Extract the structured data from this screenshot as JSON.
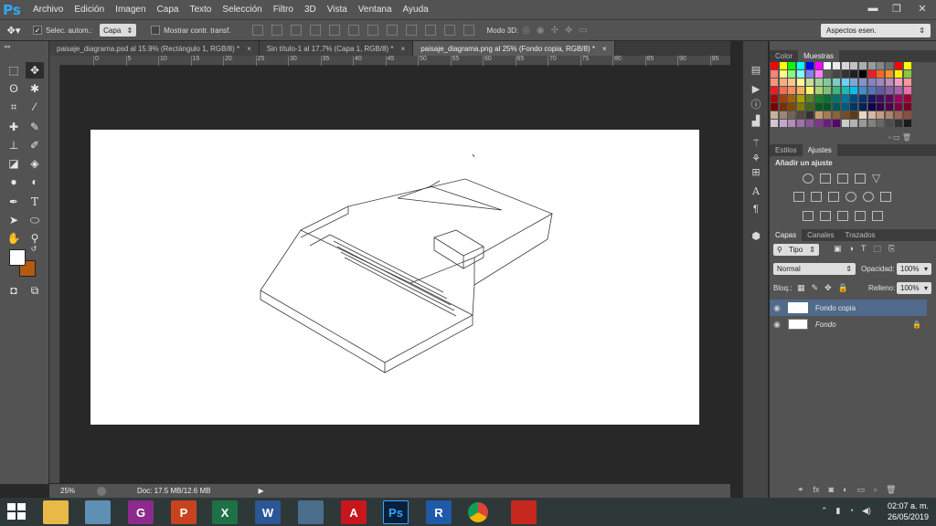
{
  "app": {
    "logo": "Ps"
  },
  "menu": [
    "Archivo",
    "Edición",
    "Imagen",
    "Capa",
    "Texto",
    "Selección",
    "Filtro",
    "3D",
    "Vista",
    "Ventana",
    "Ayuda"
  ],
  "window_controls": {
    "minimize": "▬",
    "restore": "❐",
    "close": "✕"
  },
  "options": {
    "auto_select_label": "Selec. autom.:",
    "auto_select_value": "Capa",
    "show_transform_label": "Mostrar contr. transf.",
    "mode3d_label": "Modo 3D:",
    "workspace": "Aspectos esen."
  },
  "tabs": [
    {
      "label": "paisaje_diagrama.psd al 15.9% (Rectángulo 1, RGB/8) *",
      "close": "×"
    },
    {
      "label": "Sin título-1 al 17.7% (Capa 1, RGB/8) *",
      "close": "×"
    },
    {
      "label": "paisaje_diagrama.png al 25% (Fondo copia, RGB/8) *",
      "close": "×"
    }
  ],
  "ruler": {
    "top": [
      "0",
      "5",
      "10",
      "15",
      "20",
      "25",
      "30",
      "35",
      "40",
      "45",
      "50",
      "55",
      "60",
      "65",
      "70",
      "75",
      "80",
      "85",
      "90",
      "95"
    ]
  },
  "status": {
    "zoom": "25%",
    "doc": "Doc: 17.5 MB/12.6 MB"
  },
  "panels": {
    "color_tabs": [
      "Color",
      "Muestras"
    ],
    "adjust_tabs": [
      "Estilos",
      "Ajustes"
    ],
    "adjust_title": "Añadir un ajuste",
    "layer_tabs": [
      "Capas",
      "Canales",
      "Trazados"
    ],
    "kind": "Tipo",
    "blend_mode": "Normal",
    "opacity_label": "Opacidad:",
    "opacity": "100%",
    "lock_label": "Bloq.:",
    "fill_label": "Relleno:",
    "fill": "100%",
    "layers": [
      {
        "name": "Fondo copia",
        "selected": true
      },
      {
        "name": "Fondo",
        "selected": false,
        "locked": true
      }
    ]
  },
  "clock": {
    "time": "02:07 a. m.",
    "date": "26/05/2019"
  },
  "taskbar_apps": [
    {
      "name": "windows-start",
      "label": "",
      "color": "#2e3838"
    },
    {
      "name": "file-explorer",
      "label": "",
      "color": "#e8b948"
    },
    {
      "name": "calculator",
      "label": "",
      "color": "#5f8fb5"
    },
    {
      "name": "pdf-app",
      "label": "G",
      "color": "#8d2b8d"
    },
    {
      "name": "powerpoint",
      "label": "P",
      "color": "#c7431f"
    },
    {
      "name": "excel",
      "label": "X",
      "color": "#1e7145"
    },
    {
      "name": "word",
      "label": "W",
      "color": "#2b5797"
    },
    {
      "name": "network-app",
      "label": "",
      "color": "#4a6d8c"
    },
    {
      "name": "autocad",
      "label": "A",
      "color": "#c8161d"
    },
    {
      "name": "photoshop",
      "label": "Ps",
      "color": "#0b1e3b"
    },
    {
      "name": "revit",
      "label": "R",
      "color": "#1f5aa8"
    },
    {
      "name": "chrome",
      "label": "",
      "color": "#2e3838"
    },
    {
      "name": "sketchup",
      "label": "",
      "color": "#c6271e"
    }
  ]
}
